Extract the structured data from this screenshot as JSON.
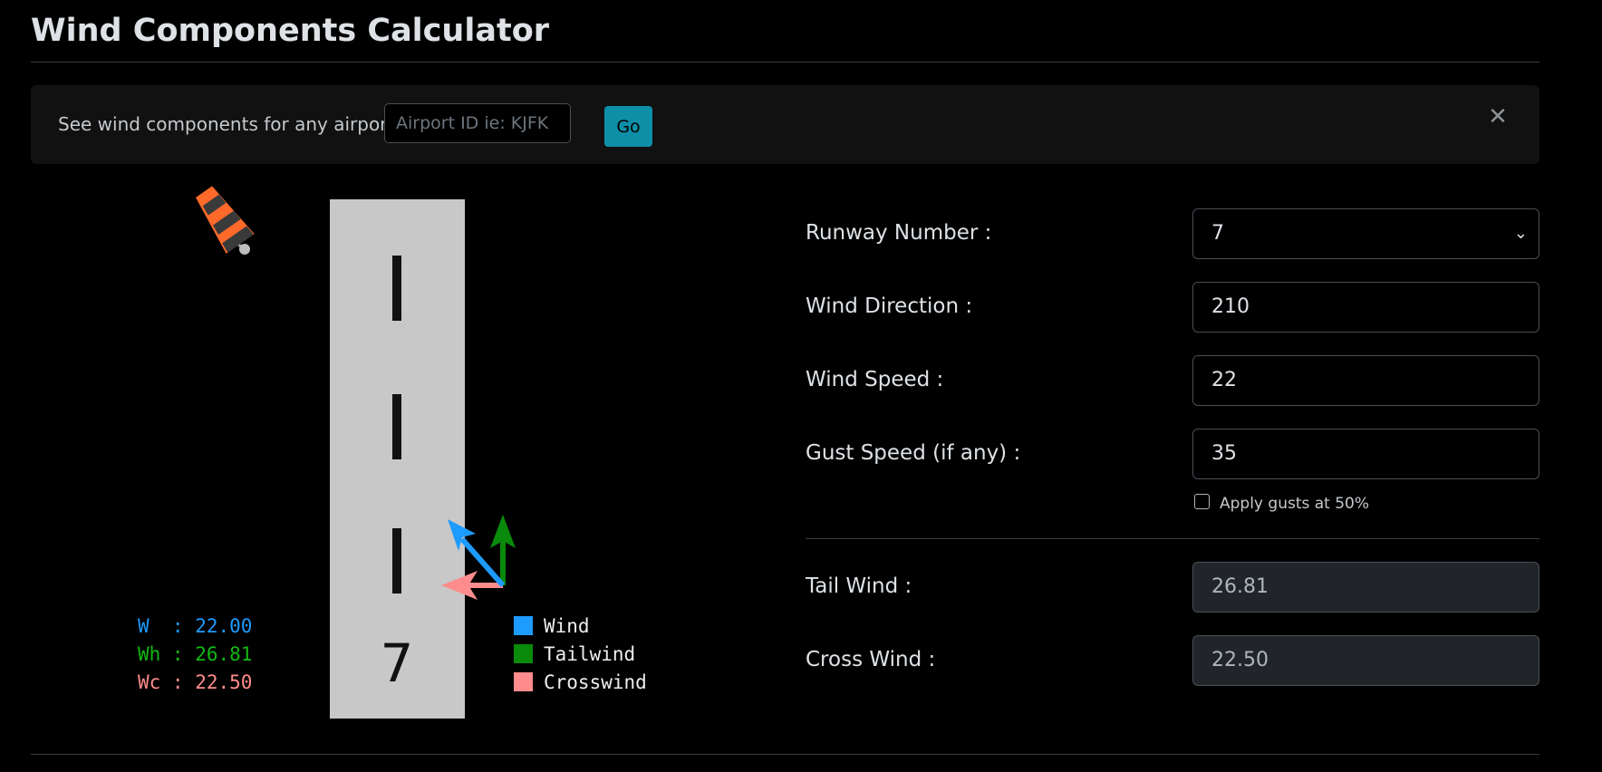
{
  "page": {
    "title": "Wind Components Calculator"
  },
  "banner": {
    "text": "See wind components for any airport.",
    "input_placeholder": "Airport ID ie: KJFK",
    "go_label": "Go",
    "close_label": "✕"
  },
  "graphic": {
    "runway_number": "7",
    "readouts": {
      "w": "W  : 22.00",
      "wh": "Wh : 26.81",
      "wc": "Wc : 22.50"
    },
    "legend": [
      {
        "label": "Wind",
        "color": "#1e9bff"
      },
      {
        "label": "Tailwind",
        "color": "#0a8a0a"
      },
      {
        "label": "Crosswind",
        "color": "#ff8c8c"
      }
    ],
    "colors": {
      "runway": "#c8c8c8",
      "windsock_orange": "#ff6a2b",
      "windsock_dark": "#3a3a3a"
    }
  },
  "form": {
    "runway_label": "Runway Number :",
    "runway_value": "7",
    "wind_direction_label": "Wind Direction :",
    "wind_direction_value": "210",
    "wind_speed_label": "Wind Speed :",
    "wind_speed_value": "22",
    "gust_label": "Gust Speed (if any) :",
    "gust_value": "35",
    "gust_checkbox_label": "Apply gusts at 50%",
    "gust_checkbox_checked": false,
    "tail_wind_label": "Tail Wind :",
    "tail_wind_value": "26.81",
    "cross_wind_label": "Cross Wind :",
    "cross_wind_value": "22.50"
  }
}
